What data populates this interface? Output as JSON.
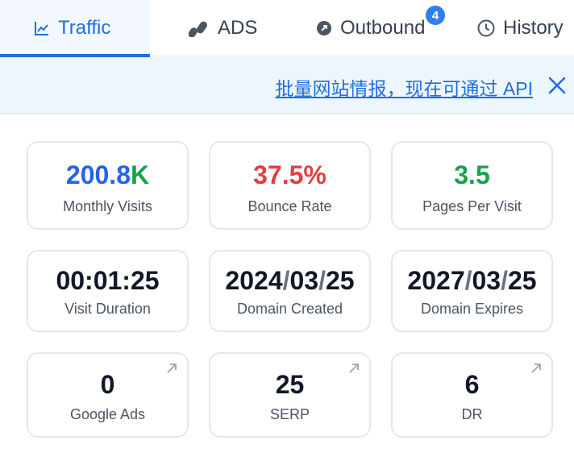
{
  "tabs": [
    {
      "label": "Traffic",
      "icon": "line-chart-icon",
      "active": true
    },
    {
      "label": "ADS",
      "icon": "ads-icon",
      "active": false
    },
    {
      "label": "Outbound",
      "icon": "outbound-icon",
      "active": false,
      "badge": "4"
    },
    {
      "label": "History",
      "icon": "clock-icon",
      "active": false
    }
  ],
  "banner": {
    "text": "批量网站情报，现在可通过 API"
  },
  "stats": {
    "monthly_visits": {
      "value_number": "200.8",
      "value_unit": "K",
      "label": "Monthly Visits"
    },
    "bounce_rate": {
      "value": "37.5%",
      "label": "Bounce Rate"
    },
    "pages_per_visit": {
      "value": "3.5",
      "label": "Pages Per Visit"
    },
    "visit_duration": {
      "value": "00:01:25",
      "label": "Visit Duration"
    },
    "domain_created": {
      "year": "2024",
      "month": "03",
      "day": "25",
      "label": "Domain Created"
    },
    "domain_expires": {
      "year": "2027",
      "month": "03",
      "day": "25",
      "label": "Domain Expires"
    },
    "google_ads": {
      "value": "0",
      "label": "Google Ads"
    },
    "serp": {
      "value": "25",
      "label": "SERP"
    },
    "dr": {
      "value": "6",
      "label": "DR"
    }
  },
  "colors": {
    "accent": "#1d6fe0",
    "monthly_visits_number": "#2563eb",
    "monthly_visits_unit": "#16a34a",
    "bounce_rate": "#e53e3e",
    "pages_per_visit": "#16a34a"
  }
}
